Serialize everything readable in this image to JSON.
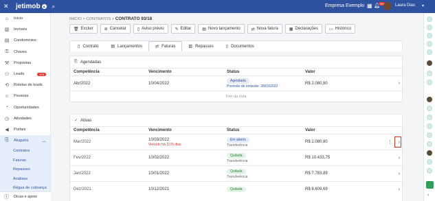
{
  "topbar": {
    "logo": "jetimob",
    "company": "Empresa Exemplo",
    "notifications": "99+",
    "user": "Laura Dias"
  },
  "sidebar": {
    "items": [
      {
        "label": "Início",
        "icon": "home-icon"
      },
      {
        "label": "Imóveis",
        "icon": "building-icon"
      },
      {
        "label": "Condomínios",
        "icon": "condo-icon"
      },
      {
        "label": "Chaves",
        "icon": "key-icon"
      },
      {
        "label": "Propostas",
        "icon": "hammer-icon"
      },
      {
        "label": "Leads",
        "icon": "leads-icon",
        "badge": "878"
      },
      {
        "label": "Roletas de leads",
        "icon": "roulette-icon"
      },
      {
        "label": "Pessoas",
        "icon": "people-icon"
      },
      {
        "label": "Oportunidades",
        "icon": "opportunity-icon"
      },
      {
        "label": "Atividades",
        "icon": "activity-icon"
      },
      {
        "label": "Portais",
        "icon": "megaphone-icon"
      },
      {
        "label": "Aluguéis",
        "icon": "rent-icon",
        "active": true
      }
    ],
    "subitems": [
      "Contratos",
      "Faturas",
      "Repasses",
      "Análises",
      "Régua de cobrança"
    ],
    "bottom": "Dicas e apoio"
  },
  "breadcrumb": {
    "first": "INÍCIO",
    "second": "CONTRATOS",
    "current": "CONTRATO 93/18"
  },
  "actions": [
    {
      "label": "Excluir",
      "icon": "trash-icon"
    },
    {
      "label": "Cancelar",
      "icon": "cancel-icon"
    },
    {
      "label": "Aviso prévio",
      "icon": "notice-icon"
    },
    {
      "label": "Editar",
      "icon": "pencil-icon"
    },
    {
      "label": "Novo lançamento",
      "icon": "document-icon"
    },
    {
      "label": "Nova fatura",
      "icon": "invoice-icon"
    },
    {
      "label": "Declarações",
      "icon": "statement-icon"
    },
    {
      "label": "Histórico",
      "icon": "history-icon"
    }
  ],
  "tabs": [
    {
      "label": "Contrato",
      "icon": "contract-icon"
    },
    {
      "label": "Lançamentos",
      "icon": "entries-icon"
    },
    {
      "label": "Faturas",
      "icon": "invoices-icon",
      "active": true
    },
    {
      "label": "Repasses",
      "icon": "transfers-icon"
    },
    {
      "label": "Documentos",
      "icon": "documents-icon"
    }
  ],
  "columns": {
    "competencia": "Competência",
    "vencimento": "Vencimento",
    "status": "Status",
    "valor": "Valor"
  },
  "scheduled": {
    "title": "Agendadas",
    "rows": [
      {
        "competencia": "Abr/2022",
        "vencimento": "10/04/2022",
        "status": "Agendada",
        "status_sub": "Previsão de emissão: 28/03/2022",
        "valor": "R$ 2.080,80"
      }
    ],
    "end_label": "Fim da lista"
  },
  "active": {
    "title": "Ativas",
    "rows": [
      {
        "competencia": "Mar/2022",
        "vencimento": "10/03/2022",
        "vencimento_sub": "Vencido há 1176 dias",
        "status": "Em aberto",
        "status_sub": "Transferência",
        "valor": "R$ 2.080,80"
      },
      {
        "competencia": "Fev/2022",
        "vencimento": "10/02/2022",
        "status": "Quitada",
        "status_sub": "Transferência",
        "valor": "R$ 10.433,75"
      },
      {
        "competencia": "Jan/2022",
        "vencimento": "10/01/2022",
        "status": "Quitada",
        "status_sub": "Transferência",
        "valor": "R$ 7.783,89"
      },
      {
        "competencia": "Dez/2021",
        "vencimento": "10/12/2021",
        "status": "Quitada",
        "status_sub": "Transferência",
        "valor": "R$ 8.609,69"
      }
    ]
  }
}
